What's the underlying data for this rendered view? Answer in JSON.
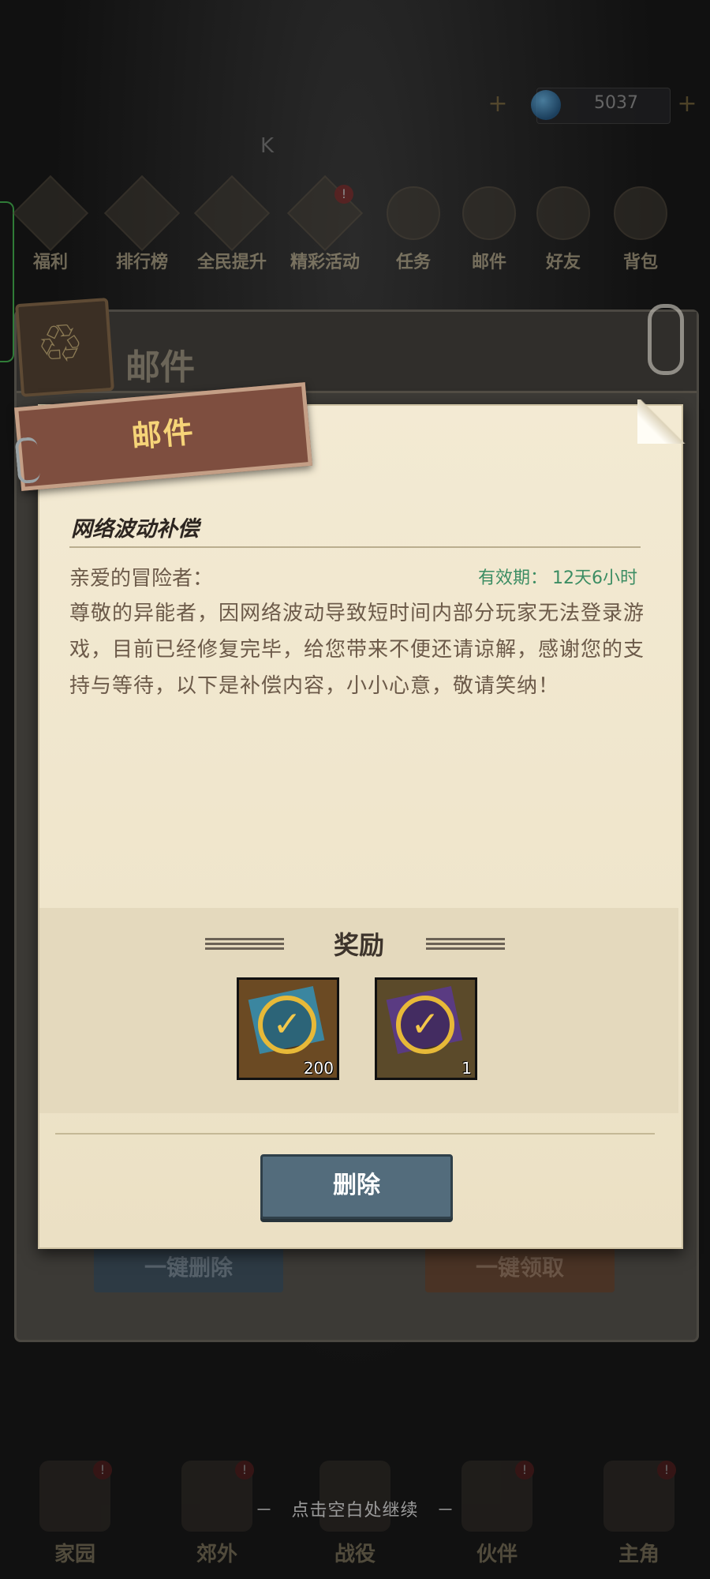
{
  "topbar": {
    "plus_label": "+",
    "gems": "5037"
  },
  "dim_text": "K",
  "nav": [
    {
      "label": "福利",
      "badge": ""
    },
    {
      "label": "排行榜",
      "badge": ""
    },
    {
      "label": "全民提升",
      "badge": ""
    },
    {
      "label": "精彩活动",
      "badge": "!"
    },
    {
      "label": "任务",
      "badge": ""
    },
    {
      "label": "邮件",
      "badge": ""
    },
    {
      "label": "好友",
      "badge": ""
    },
    {
      "label": "背包",
      "badge": ""
    }
  ],
  "outer": {
    "title": "邮件",
    "delete_all": "一键删除",
    "claim_all": "一键领取"
  },
  "mail": {
    "ribbon_title": "邮件",
    "title": "网络波动补偿",
    "greeting": "亲爱的冒险者：",
    "validity_label": "有效期：",
    "validity_value": "12天6小时",
    "body": "尊敬的异能者，因网络波动导致短时间内部分玩家无法登录游戏，目前已经修复完毕，给您带来不便还请谅解，感谢您的支持与等待，以下是补偿内容，小小心意，敬请笑纳！",
    "reward_title": "奖励",
    "rewards": [
      {
        "icon": "blue-ticket-icon",
        "quantity": "200"
      },
      {
        "icon": "purple-ticket-icon",
        "quantity": "1"
      }
    ],
    "delete_label": "删除"
  },
  "bottom_nav": [
    {
      "label": "家园",
      "badge": "!"
    },
    {
      "label": "郊外",
      "badge": "!"
    },
    {
      "label": "战役",
      "badge": ""
    },
    {
      "label": "伙伴",
      "badge": "!"
    },
    {
      "label": "主角",
      "badge": "!"
    }
  ],
  "continue_hint": "－　点击空白处继续　－",
  "colors": {
    "validity": "#3c8d63",
    "ribbon": "#7e4e3f",
    "ribbon_text": "#f6d478",
    "delete_button": "#536c7c",
    "paper": "#f3ead3"
  }
}
